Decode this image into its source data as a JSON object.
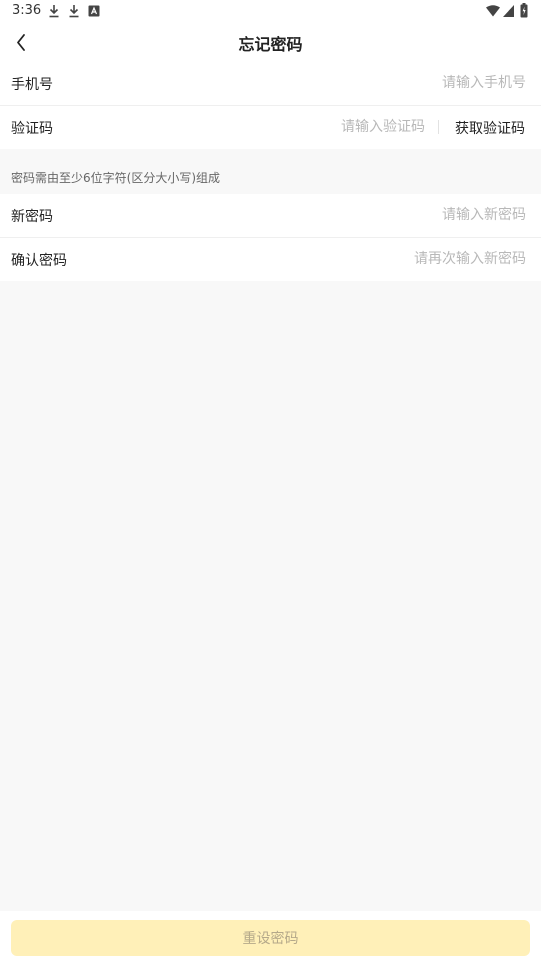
{
  "status_bar": {
    "time": "3:36",
    "icons": [
      "download-icon",
      "download-icon",
      "app-notification-icon",
      "wifi-icon",
      "signal-icon",
      "battery-icon"
    ]
  },
  "header": {
    "title": "忘记密码",
    "back_icon": "chevron-left-icon"
  },
  "phone_row": {
    "label": "手机号",
    "placeholder": "请输入手机号",
    "value": ""
  },
  "code_row": {
    "label": "验证码",
    "placeholder": "请输入验证码",
    "value": "",
    "get_code_label": "获取验证码"
  },
  "password_hint": "密码需由至少6位字符(区分大小写)组成",
  "new_password_row": {
    "label": "新密码",
    "placeholder": "请输入新密码",
    "value": ""
  },
  "confirm_password_row": {
    "label": "确认密码",
    "placeholder": "请再次输入新密码",
    "value": ""
  },
  "submit": {
    "label": "重设密码"
  },
  "colors": {
    "page_background": "#f8f8f8",
    "button_background_disabled": "#fff0b8",
    "button_text_disabled": "#b5a98a",
    "placeholder": "#b8b8b8"
  }
}
